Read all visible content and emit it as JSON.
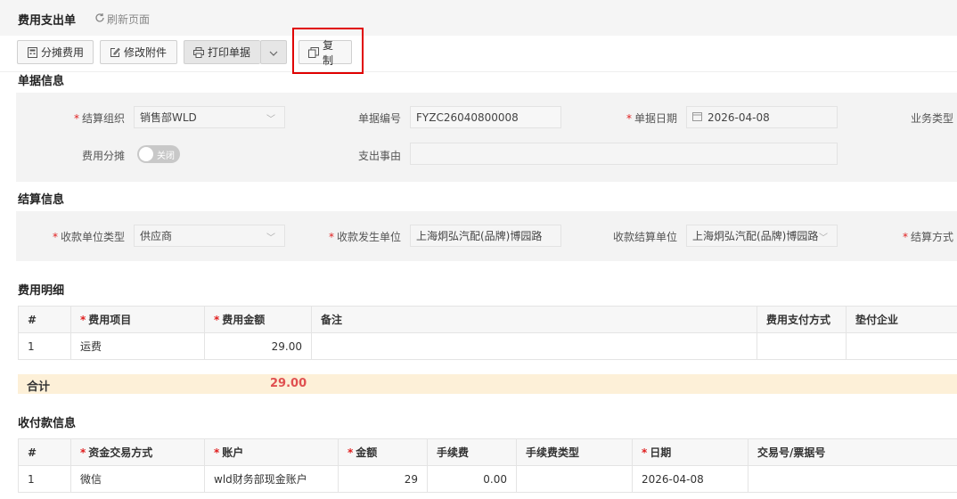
{
  "page": {
    "title": "费用支出单",
    "refresh_label": "刷新页面"
  },
  "toolbar": {
    "allocate_label": "分摊费用",
    "attach_label": "修改附件",
    "print_label": "打印单据",
    "copy_label": "复制"
  },
  "sections": {
    "doc_info": "单据信息",
    "settle_info": "结算信息",
    "fee_detail": "费用明细",
    "payment_info": "收付款信息"
  },
  "doc_info": {
    "org_label": "结算组织",
    "org_value": "销售部WLD",
    "docno_label": "单据编号",
    "docno_value": "FYZC26040800008",
    "date_label": "单据日期",
    "date_value": "2026-04-08",
    "biztype_label": "业务类型",
    "allocate_label": "费用分摊",
    "allocate_toggle": "关闭",
    "reason_label": "支出事由",
    "reason_value": ""
  },
  "settle_info": {
    "payee_type_label": "收款单位类型",
    "payee_type_value": "供应商",
    "payee_unit_label": "收款发生单位",
    "payee_unit_value": "上海炯弘汽配(品牌)博园路",
    "settle_unit_label": "收款结算单位",
    "settle_unit_value": "上海炯弘汽配(品牌)博园路",
    "settle_method_label": "结算方式"
  },
  "fee_table": {
    "headers": [
      "#",
      "费用项目",
      "费用金额",
      "备注",
      "费用支付方式",
      "垫付企业"
    ],
    "rows": [
      {
        "idx": "1",
        "item": "运费",
        "amount": "29.00",
        "remark": "",
        "pay_method": "",
        "advance": ""
      }
    ],
    "total_label": "合计",
    "total_value": "29.00"
  },
  "pay_table": {
    "headers": [
      "#",
      "资金交易方式",
      "账户",
      "金额",
      "手续费",
      "手续费类型",
      "日期",
      "交易号/票据号"
    ],
    "rows": [
      {
        "idx": "1",
        "method": "微信",
        "account": "wld财务部现金账户",
        "amount": "29",
        "fee": "0.00",
        "fee_type": "",
        "date": "2026-04-08",
        "trade_no": ""
      }
    ]
  }
}
